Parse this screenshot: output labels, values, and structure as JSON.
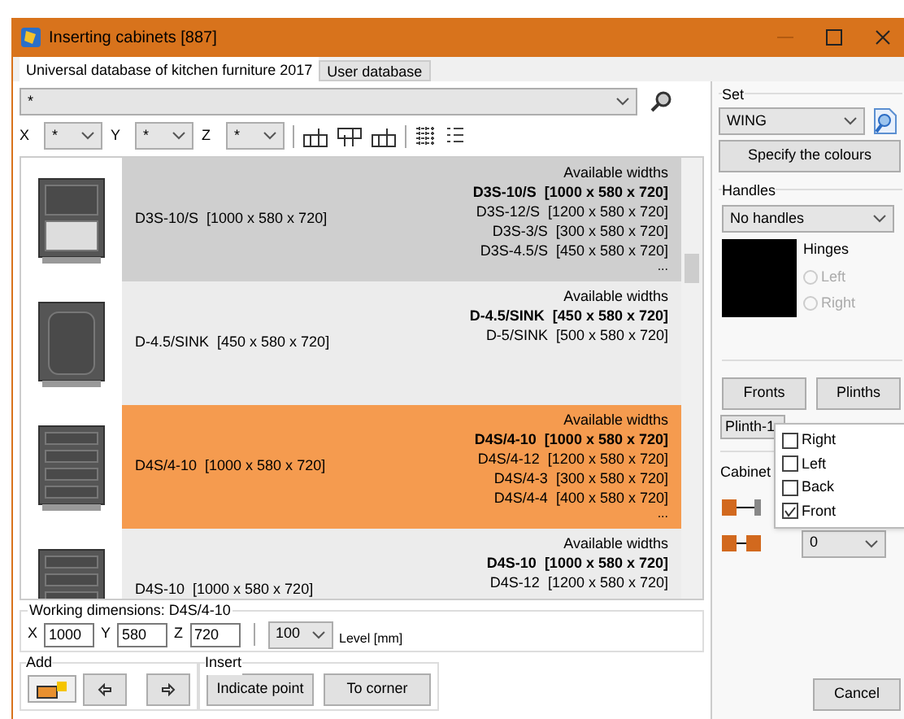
{
  "window": {
    "title": "Inserting cabinets [887]"
  },
  "tabs": [
    {
      "label": "Universal database of kitchen furniture 2017",
      "selected": true
    },
    {
      "label": "User database",
      "selected": false
    }
  ],
  "filter": {
    "value": "*"
  },
  "axes": [
    {
      "label": "X",
      "value": "*"
    },
    {
      "label": "Y",
      "value": "*"
    },
    {
      "label": "Z",
      "value": "*"
    }
  ],
  "rows": [
    {
      "kind": "drawers2",
      "name": "D3S-10/S  [1000 x 580 x 720]",
      "selected": false,
      "highlighted": true,
      "heading": "Available widths",
      "widths": [
        {
          "text": "D3S-10/S  [1000 x 580 x 720]",
          "current": true
        },
        {
          "text": "D3S-12/S  [1200 x 580 x 720]",
          "current": false
        },
        {
          "text": "D3S-3/S  [300 x 580 x 720]",
          "current": false
        },
        {
          "text": "D3S-4.5/S  [450 x 580 x 720]",
          "current": false
        }
      ],
      "more": "..."
    },
    {
      "kind": "door",
      "name": "D-4.5/SINK  [450 x 580 x 720]",
      "selected": false,
      "highlighted": false,
      "heading": "Available widths",
      "widths": [
        {
          "text": "D-4.5/SINK  [450 x 580 x 720]",
          "current": true
        },
        {
          "text": "D-5/SINK  [500 x 580 x 720]",
          "current": false
        }
      ]
    },
    {
      "kind": "drawers4",
      "name": "D4S/4-10  [1000 x 580 x 720]",
      "selected": true,
      "highlighted": false,
      "heading": "Available widths",
      "widths": [
        {
          "text": "D4S/4-10  [1000 x 580 x 720]",
          "current": true
        },
        {
          "text": "D4S/4-12  [1200 x 580 x 720]",
          "current": false
        },
        {
          "text": "D4S/4-3  [300 x 580 x 720]",
          "current": false
        },
        {
          "text": "D4S/4-4  [400 x 580 x 720]",
          "current": false
        }
      ],
      "more": "..."
    },
    {
      "kind": "drawers4",
      "name": "D4S-10  [1000 x 580 x 720]",
      "selected": false,
      "highlighted": false,
      "heading": "Available widths",
      "widths": [
        {
          "text": "D4S-10  [1000 x 580 x 720]",
          "current": true
        },
        {
          "text": "D4S-12  [1200 x 580 x 720]",
          "current": false
        }
      ]
    }
  ],
  "working": {
    "title": "Working dimensions: D4S/4-10",
    "fields": [
      {
        "label": "X",
        "value": "1000"
      },
      {
        "label": "Y",
        "value": "580"
      },
      {
        "label": "Z",
        "value": "720"
      }
    ],
    "level": "100",
    "level_label": "Level [mm]"
  },
  "add": {
    "title": "Add"
  },
  "insert": {
    "title": "Insert",
    "buttons": [
      "Indicate point",
      "To corner"
    ]
  },
  "cancel": "Cancel",
  "set": {
    "title": "Set",
    "value": "WING",
    "button": "Specify the colours"
  },
  "handles": {
    "title": "Handles",
    "value": "No handles",
    "hinges": "Hinges",
    "options": [
      {
        "label": "Left",
        "selected": false,
        "disabled": true
      },
      {
        "label": "Right",
        "selected": false,
        "disabled": true
      }
    ]
  },
  "buttons": [
    "Fronts",
    "Plinths"
  ],
  "plinth": {
    "value": "Plinth-1"
  },
  "menu": [
    {
      "label": "Right",
      "checked": false
    },
    {
      "label": "Left",
      "checked": false
    },
    {
      "label": "Back",
      "checked": false
    },
    {
      "label": "Front",
      "checked": true
    }
  ],
  "cabinet": {
    "title": "Cabinet",
    "value": "0"
  }
}
